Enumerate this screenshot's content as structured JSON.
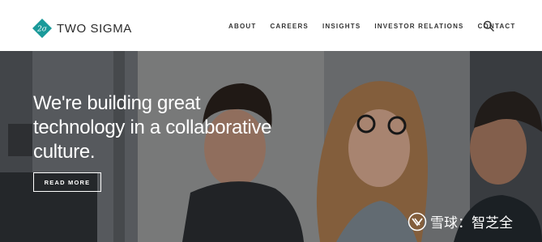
{
  "header": {
    "logo_mark": "2σ",
    "logo_text": "TWO SIGMA",
    "nav": [
      "ABOUT",
      "CAREERS",
      "INSIGHTS",
      "INVESTOR RELATIONS",
      "CONTACT"
    ],
    "search_icon": "search-icon"
  },
  "hero": {
    "headline": "We're building great technology in a collaborative culture.",
    "button_label": "READ MORE"
  },
  "watermark": {
    "text": "雪球：智芝全"
  },
  "colors": {
    "brand_teal": "#1a9a9a",
    "header_bg": "#ffffff",
    "hero_text": "#ffffff"
  }
}
